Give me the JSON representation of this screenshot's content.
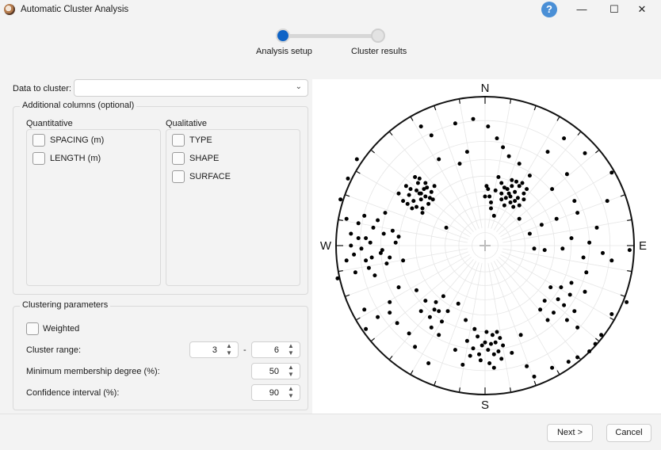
{
  "window": {
    "title": "Automatic Cluster Analysis",
    "help_glyph": "?",
    "controls": {
      "minimize": "—",
      "maximize": "☐",
      "close": "✕"
    }
  },
  "stepper": {
    "steps": [
      {
        "label": "Analysis setup",
        "state": "active"
      },
      {
        "label": "Cluster results",
        "state": "inactive"
      }
    ],
    "active_color": "#0e63c6"
  },
  "data_to_cluster": {
    "label": "Data to cluster:",
    "value": "",
    "chevron_icon": "chevron-down-icon"
  },
  "additional_columns": {
    "title": "Additional columns (optional)",
    "quantitative": {
      "heading": "Quantitative",
      "items": [
        {
          "label": "SPACING (m)",
          "checked": false
        },
        {
          "label": "LENGTH (m)",
          "checked": false
        }
      ]
    },
    "qualitative": {
      "heading": "Qualitative",
      "items": [
        {
          "label": "TYPE",
          "checked": false
        },
        {
          "label": "SHAPE",
          "checked": false
        },
        {
          "label": "SURFACE",
          "checked": false
        }
      ]
    }
  },
  "clustering_parameters": {
    "title": "Clustering parameters",
    "weighted": {
      "label": "Weighted",
      "checked": false
    },
    "cluster_range": {
      "label": "Cluster range:",
      "min": "3",
      "separator": "-",
      "max": "6"
    },
    "min_membership": {
      "label": "Minimum membership degree (%):",
      "value": "50"
    },
    "confidence": {
      "label": "Confidence interval (%):",
      "value": "90"
    }
  },
  "stereonet": {
    "directions": {
      "north": "N",
      "east": "E",
      "south": "S",
      "west": "W"
    },
    "point_color": "#000000",
    "grid_color": "#e6e6e6",
    "poles": [
      [
        0.23,
        0.4
      ],
      [
        0.2,
        0.36
      ],
      [
        0.21,
        0.43
      ],
      [
        0.18,
        0.44
      ],
      [
        0.15,
        0.38
      ],
      [
        0.17,
        0.33
      ],
      [
        0.11,
        0.35
      ],
      [
        0.13,
        0.27
      ],
      [
        0.17,
        0.29
      ],
      [
        0.2,
        0.3
      ],
      [
        0.07,
        0.37
      ],
      [
        0.03,
        0.33
      ],
      [
        0.04,
        0.29
      ],
      [
        0.02,
        0.38
      ],
      [
        0.11,
        0.31
      ],
      [
        0.26,
        0.35
      ],
      [
        0.26,
        0.31
      ],
      [
        0.28,
        0.38
      ],
      [
        0.13,
        0.39
      ],
      [
        0.19,
        0.26
      ],
      [
        0.22,
        0.32
      ],
      [
        0.11,
        0.42
      ],
      [
        0.01,
        0.4
      ],
      [
        0.04,
        0.25
      ],
      [
        0.09,
        0.46
      ],
      [
        0.16,
        0.35
      ],
      [
        0.23,
        0.27
      ],
      [
        0.25,
        0.42
      ],
      [
        0.0,
        0.33
      ],
      [
        0.14,
        0.32
      ],
      [
        0.18,
        0.4
      ],
      [
        -0.44,
        0.35
      ],
      [
        -0.41,
        0.38
      ],
      [
        -0.43,
        0.31
      ],
      [
        -0.4,
        0.33
      ],
      [
        -0.45,
        0.42
      ],
      [
        -0.38,
        0.28
      ],
      [
        -0.42,
        0.25
      ],
      [
        -0.48,
        0.3
      ],
      [
        -0.46,
        0.37
      ],
      [
        -0.51,
        0.34
      ],
      [
        -0.53,
        0.4
      ],
      [
        -0.4,
        0.42
      ],
      [
        -0.36,
        0.36
      ],
      [
        -0.49,
        0.25
      ],
      [
        -0.44,
        0.45
      ],
      [
        -0.55,
        0.3
      ],
      [
        -0.37,
        0.32
      ],
      [
        -0.47,
        0.46
      ],
      [
        -0.42,
        0.22
      ],
      [
        -0.39,
        0.39
      ],
      [
        -0.5,
        0.38
      ],
      [
        -0.34,
        0.4
      ],
      [
        -0.43,
        0.35
      ],
      [
        -0.52,
        0.28
      ],
      [
        -0.58,
        0.35
      ],
      [
        -0.46,
        0.26
      ],
      [
        -0.35,
        0.31
      ],
      [
        -0.04,
        -0.73
      ],
      [
        0.0,
        -0.65
      ],
      [
        -0.08,
        -0.69
      ],
      [
        0.04,
        -0.66
      ],
      [
        0.06,
        -0.73
      ],
      [
        0.01,
        -0.58
      ],
      [
        -0.05,
        -0.61
      ],
      [
        0.09,
        -0.71
      ],
      [
        -0.1,
        -0.74
      ],
      [
        0.03,
        -0.79
      ],
      [
        -0.15,
        -0.8
      ],
      [
        0.07,
        -0.65
      ],
      [
        -0.02,
        -0.67
      ],
      [
        0.11,
        -0.76
      ],
      [
        0.05,
        -0.6
      ],
      [
        -0.07,
        -0.56
      ],
      [
        0.12,
        -0.67
      ],
      [
        0.02,
        -0.7
      ],
      [
        -0.12,
        -0.64
      ],
      [
        0.06,
        -0.82
      ],
      [
        -0.03,
        -0.77
      ],
      [
        0.08,
        -0.58
      ],
      [
        0.1,
        -0.62
      ],
      [
        -0.31,
        -0.44
      ],
      [
        -0.37,
        -0.48
      ],
      [
        -0.33,
        -0.38
      ],
      [
        -0.4,
        -0.37
      ],
      [
        -0.28,
        -0.34
      ],
      [
        -0.36,
        -0.55
      ],
      [
        -0.43,
        -0.44
      ],
      [
        -0.29,
        -0.51
      ],
      [
        -0.46,
        -0.3
      ],
      [
        -0.25,
        -0.44
      ],
      [
        -0.31,
        -0.6
      ],
      [
        -0.34,
        -0.43
      ],
      [
        0.57,
        -0.33
      ],
      [
        0.53,
        -0.4
      ],
      [
        0.49,
        -0.36
      ],
      [
        0.44,
        -0.28
      ],
      [
        0.6,
        -0.44
      ],
      [
        0.46,
        -0.45
      ],
      [
        0.4,
        -0.37
      ],
      [
        0.55,
        -0.5
      ],
      [
        0.67,
        -0.31
      ],
      [
        0.51,
        -0.28
      ],
      [
        0.42,
        -0.5
      ],
      [
        0.62,
        -0.55
      ],
      [
        0.37,
        -0.43
      ],
      [
        0.58,
        -0.25
      ],
      [
        0.79,
        -0.05
      ],
      [
        0.85,
        -0.1
      ],
      [
        0.7,
        0.02
      ],
      [
        0.66,
        -0.08
      ],
      [
        0.58,
        0.05
      ],
      [
        0.52,
        -0.02
      ],
      [
        0.48,
        0.18
      ],
      [
        0.62,
        0.22
      ],
      [
        0.45,
        0.38
      ],
      [
        0.38,
        0.14
      ],
      [
        0.3,
        0.08
      ],
      [
        0.75,
        0.12
      ],
      [
        0.82,
        0.3
      ],
      [
        0.55,
        0.48
      ],
      [
        0.97,
        -0.03
      ],
      [
        0.68,
        -0.18
      ],
      [
        0.06,
        0.2
      ],
      [
        0.23,
        0.18
      ],
      [
        -0.17,
        0.55
      ],
      [
        -0.26,
        0.12
      ],
      [
        0.4,
        -0.03
      ],
      [
        0.33,
        -0.02
      ],
      [
        -0.85,
        0.05
      ],
      [
        -0.9,
        0.08
      ],
      [
        -0.77,
        0.02
      ],
      [
        -0.8,
        -0.1
      ],
      [
        -0.7,
        -0.05
      ],
      [
        -0.75,
        0.12
      ],
      [
        -0.68,
        0.08
      ],
      [
        -0.83,
        -0.02
      ],
      [
        -0.72,
        0.17
      ],
      [
        -0.66,
        -0.12
      ],
      [
        -0.88,
        -0.06
      ],
      [
        -0.78,
        -0.15
      ],
      [
        -0.6,
        0.02
      ],
      [
        -0.93,
        -0.1
      ],
      [
        -0.74,
        -0.2
      ],
      [
        -0.62,
        0.1
      ],
      [
        -0.85,
        0.15
      ],
      [
        -0.69,
        -0.03
      ],
      [
        -0.81,
        0.2
      ],
      [
        -0.64,
        -0.08
      ],
      [
        -0.9,
        0.0
      ],
      [
        -0.58,
        0.06
      ],
      [
        -0.76,
        -0.08
      ],
      [
        -0.87,
        -0.18
      ],
      [
        -0.99,
        -0.22
      ],
      [
        -0.67,
        0.22
      ],
      [
        -0.55,
        -0.1
      ],
      [
        -0.8,
        0.05
      ],
      [
        0.3,
        0.47
      ],
      [
        0.23,
        0.55
      ],
      [
        0.16,
        0.6
      ],
      [
        0.12,
        0.66
      ],
      [
        0.08,
        0.72
      ],
      [
        0.02,
        0.8
      ],
      [
        -0.08,
        0.85
      ],
      [
        -0.2,
        0.82
      ],
      [
        -0.36,
        0.74
      ],
      [
        -0.43,
        0.8
      ],
      [
        -0.31,
        0.58
      ],
      [
        -0.12,
        0.63
      ],
      [
        -0.8,
        -0.56
      ],
      [
        -0.72,
        -0.48
      ],
      [
        -0.64,
        -0.38
      ],
      [
        -0.59,
        -0.52
      ],
      [
        -0.58,
        -0.28
      ],
      [
        -0.64,
        -0.45
      ],
      [
        -0.81,
        -0.43
      ],
      [
        -0.51,
        -0.59
      ],
      [
        -0.47,
        -0.68
      ],
      [
        -0.38,
        -0.79
      ],
      [
        -0.2,
        -0.7
      ],
      [
        -0.13,
        -0.5
      ],
      [
        -0.18,
        -0.39
      ],
      [
        0.85,
        -0.46
      ],
      [
        0.78,
        -0.6
      ],
      [
        0.7,
        -0.71
      ],
      [
        0.62,
        -0.75
      ],
      [
        0.56,
        -0.78
      ],
      [
        0.45,
        -0.82
      ],
      [
        0.33,
        -0.88
      ],
      [
        0.28,
        -0.81
      ],
      [
        0.18,
        -0.72
      ],
      [
        0.24,
        -0.6
      ],
      [
        0.95,
        -0.38
      ],
      [
        0.74,
        -0.66
      ],
      [
        -0.97,
        0.31
      ],
      [
        -0.92,
        0.45
      ],
      [
        -0.86,
        0.58
      ],
      [
        -0.93,
        0.18
      ],
      [
        0.42,
        0.63
      ],
      [
        0.53,
        0.72
      ],
      [
        0.6,
        0.3
      ],
      [
        0.67,
        0.62
      ],
      [
        0.85,
        0.49
      ]
    ]
  }
}
